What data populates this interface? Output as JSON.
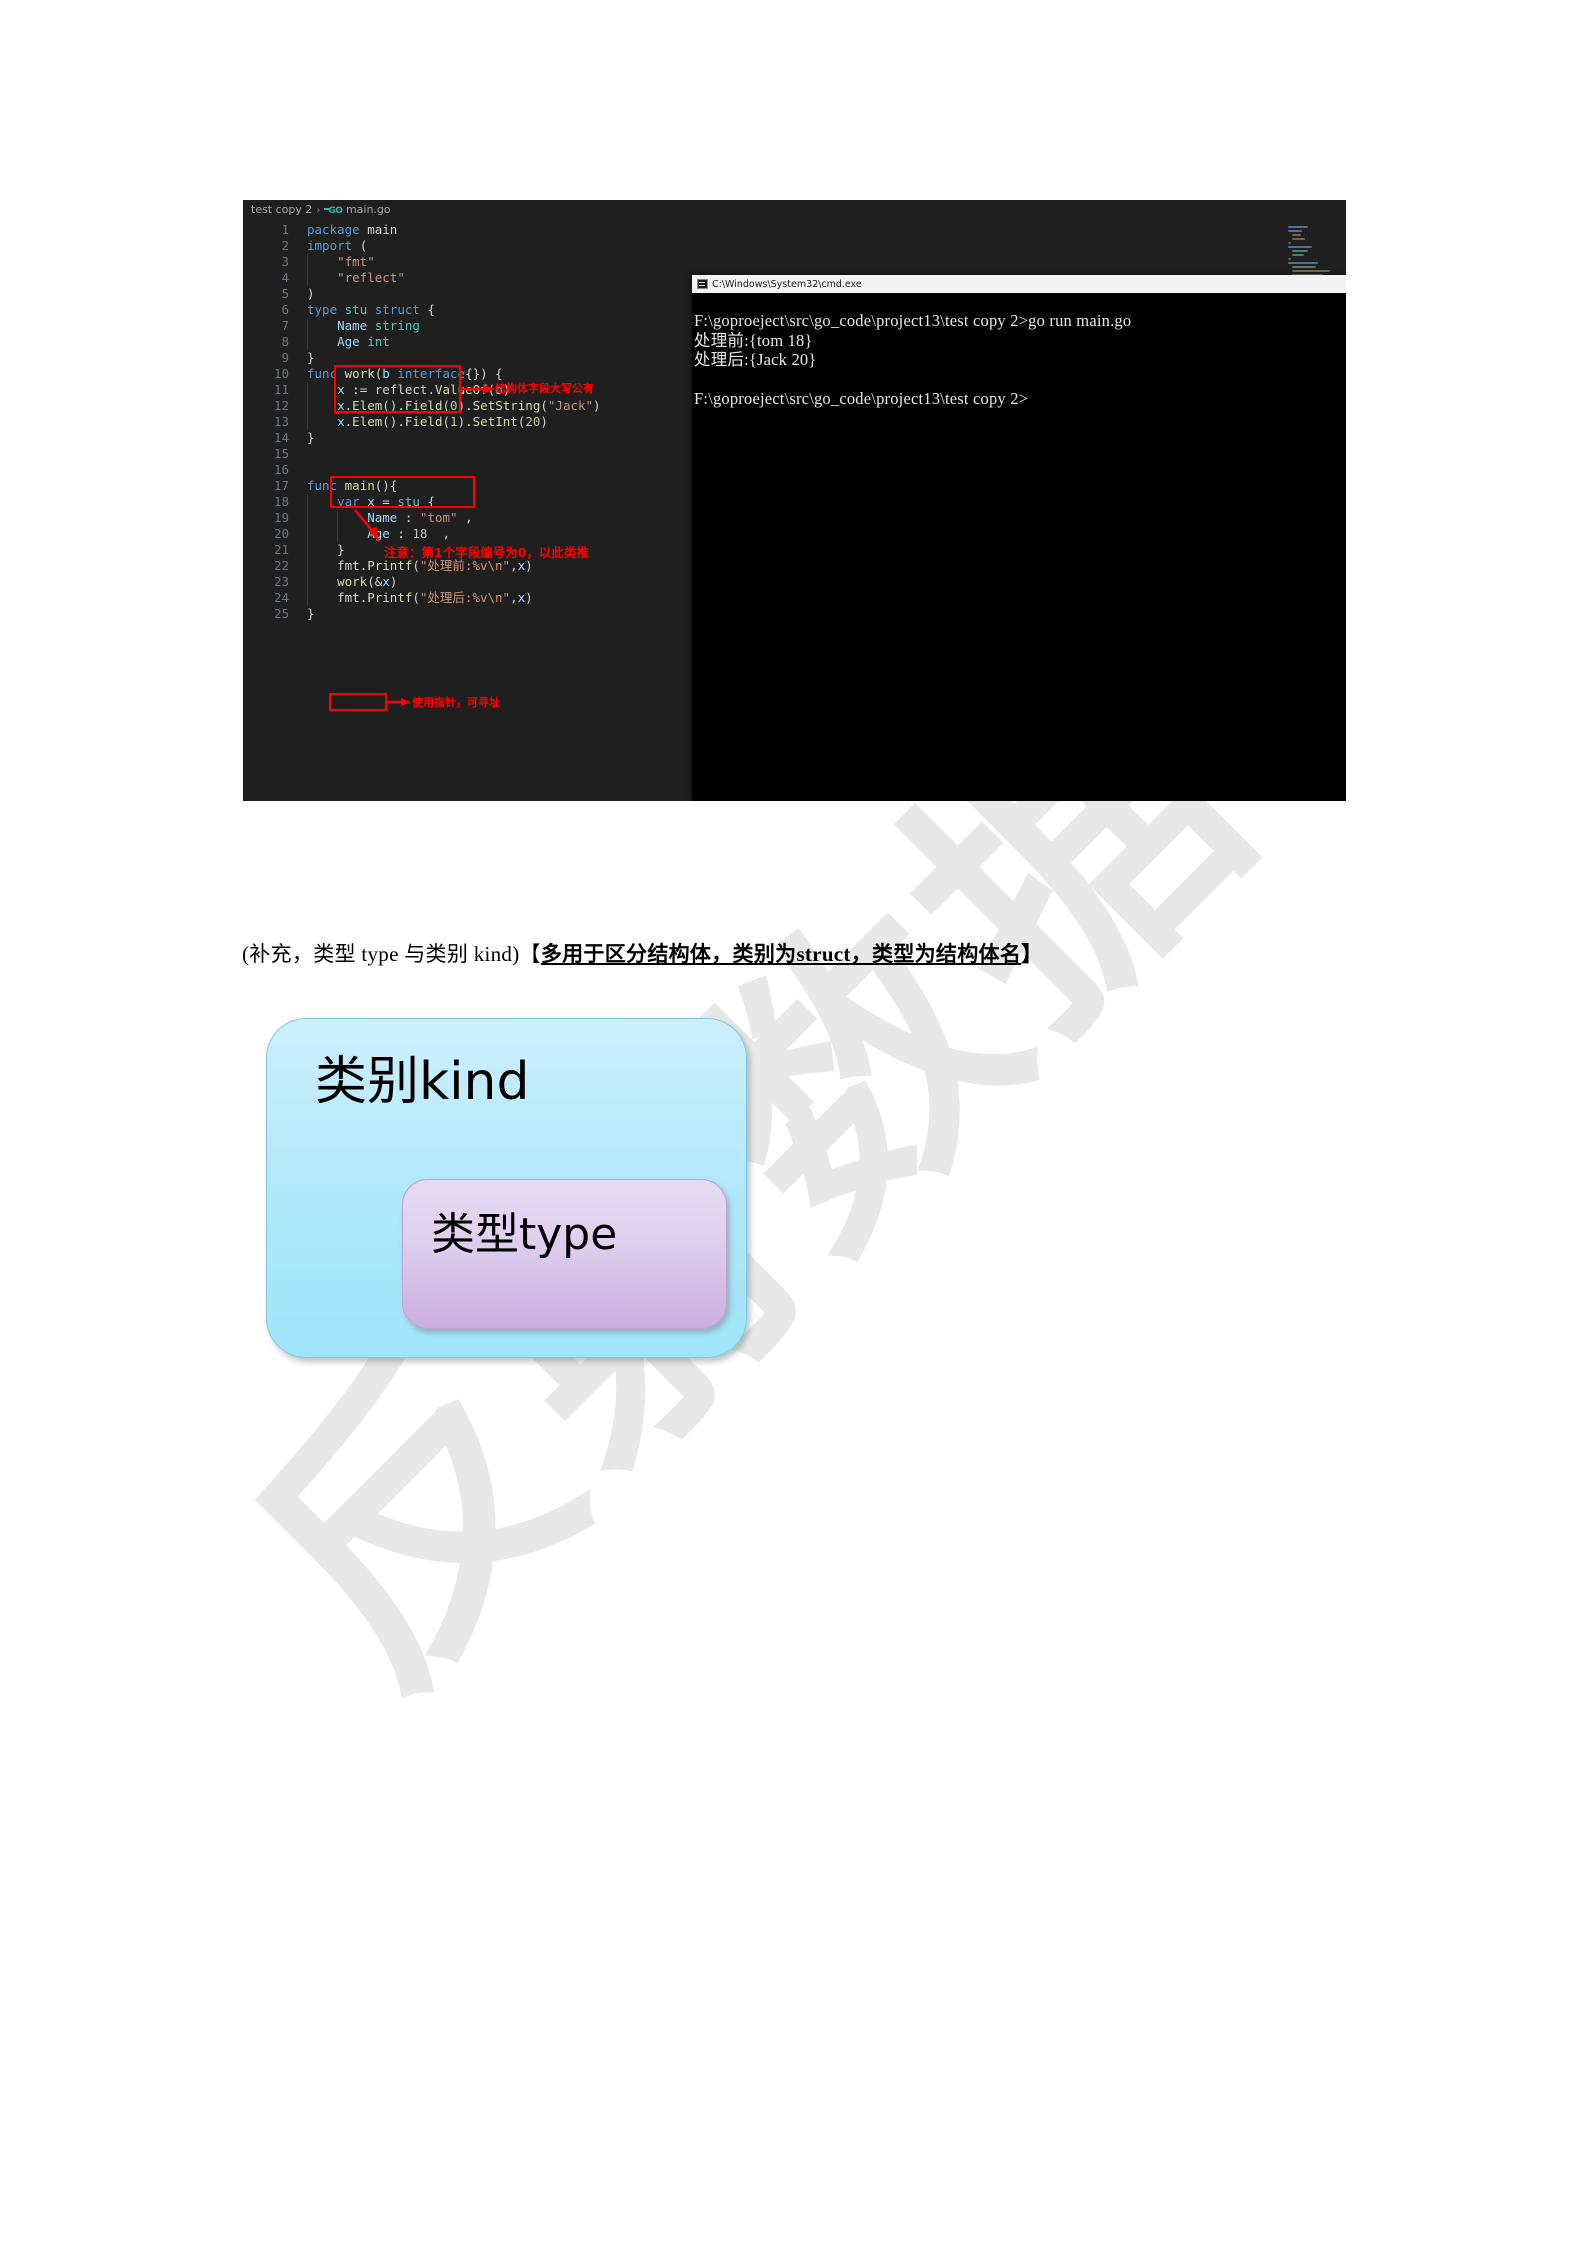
{
  "watermark": {
    "text": "反射数据"
  },
  "editor": {
    "breadcrumb_project": "test copy 2",
    "breadcrumb_separator": "›",
    "breadcrumb_lang_icon": "go-logo-icon",
    "breadcrumb_lang": "GO",
    "breadcrumb_file": "main.go",
    "lines": [
      {
        "n": "1",
        "text": "package main"
      },
      {
        "n": "2",
        "text": "import ("
      },
      {
        "n": "3",
        "text": "    \"fmt\""
      },
      {
        "n": "4",
        "text": "    \"reflect\""
      },
      {
        "n": "5",
        "text": ")"
      },
      {
        "n": "6",
        "text": "type stu struct {"
      },
      {
        "n": "7",
        "text": "    Name string"
      },
      {
        "n": "8",
        "text": "    Age int"
      },
      {
        "n": "9",
        "text": "}"
      },
      {
        "n": "10",
        "text": "func work(b interface{}) {"
      },
      {
        "n": "11",
        "text": "    x := reflect.ValueOf(b)"
      },
      {
        "n": "12",
        "text": "    x.Elem().Field(0).SetString(\"Jack\")"
      },
      {
        "n": "13",
        "text": "    x.Elem().Field(1).SetInt(20)"
      },
      {
        "n": "14",
        "text": "}"
      },
      {
        "n": "15",
        "text": ""
      },
      {
        "n": "16",
        "text": ""
      },
      {
        "n": "17",
        "text": "func main(){"
      },
      {
        "n": "18",
        "text": "    var x = stu {"
      },
      {
        "n": "19",
        "text": "        Name : \"tom\" ,"
      },
      {
        "n": "20",
        "text": "        Age : 18  ,"
      },
      {
        "n": "21",
        "text": "    }"
      },
      {
        "n": "22",
        "text": "    fmt.Printf(\"处理前:%v\\n\",x)"
      },
      {
        "n": "23",
        "text": "    work(&x)"
      },
      {
        "n": "24",
        "text": "    fmt.Printf(\"处理后:%v\\n\",x)"
      },
      {
        "n": "25",
        "text": "}"
      }
    ],
    "annotations": {
      "struct_fields": "结构体字段大写公有",
      "field_index": "注意：第1个字段编号为0，以此类推",
      "pointer": "使用指针，可寻址"
    },
    "colors": {
      "background": "#1f1f1f",
      "keyword": "#569cd6",
      "type": "#4ec9b0",
      "string": "#ce9178",
      "function": "#dcdcaa",
      "number": "#b5cea8",
      "line_number": "#6e7681",
      "annotation_red": "#ff0000"
    }
  },
  "terminal": {
    "title": "C:\\Windows\\System32\\cmd.exe",
    "icon": "cmd-window-icon",
    "output": "F:\\goproeject\\src\\go_code\\project13\\test copy 2>go run main.go\n处理前:{tom 18}\n处理后:{Jack 20}\n\nF:\\goproeject\\src\\go_code\\project13\\test copy 2>"
  },
  "caption": {
    "prefix": "(补充，类型 type 与类别 kind)【",
    "emphasis_a": "多用于区分结构体，类别为",
    "emphasis_b": "struct",
    "emphasis_c": "，类型为结构体名",
    "suffix": "】"
  },
  "diagram": {
    "outer_label": "类别kind",
    "inner_label": "类型type",
    "outer_color": "#b3e9fb",
    "inner_color": "#d8c4ea"
  }
}
